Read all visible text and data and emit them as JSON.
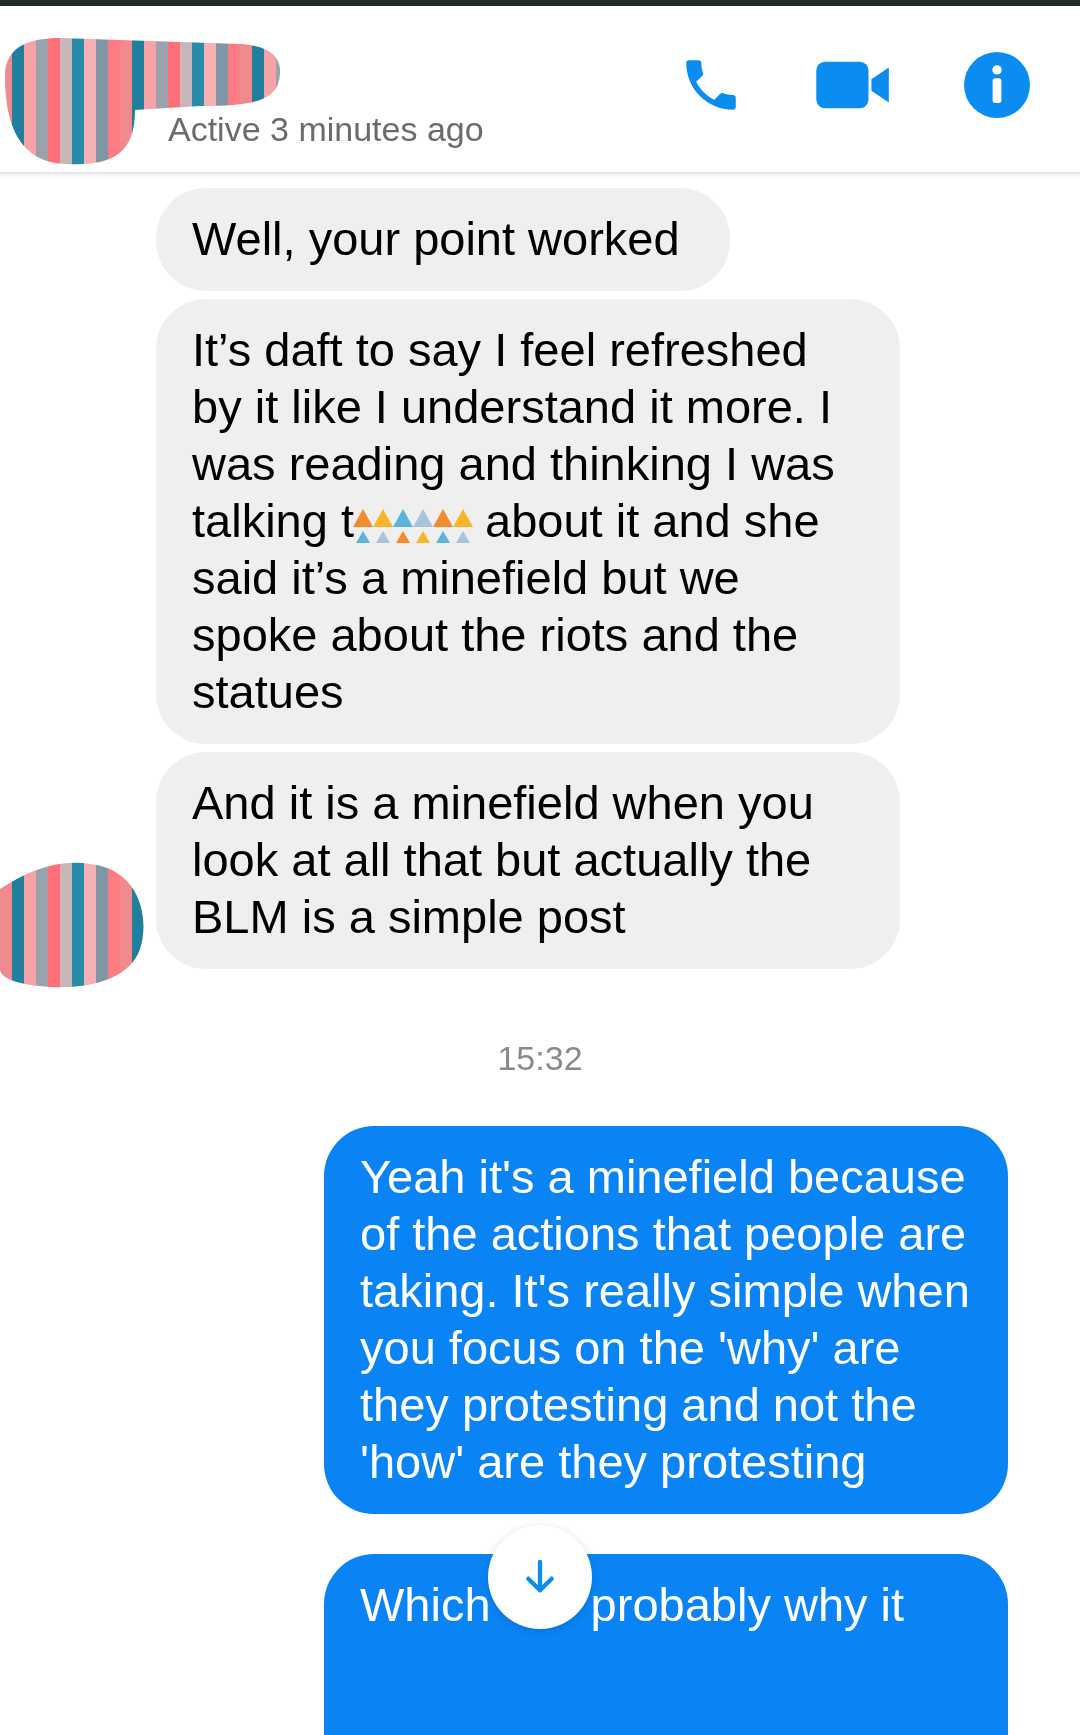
{
  "header": {
    "status": "Active 3 minutes ago",
    "actions": [
      {
        "kind": "call"
      },
      {
        "kind": "video"
      },
      {
        "kind": "info"
      }
    ]
  },
  "messages": [
    {
      "kind": "incoming",
      "parts": [
        {
          "kind": "text",
          "text": "Well, your point worked"
        }
      ]
    },
    {
      "kind": "incoming",
      "parts": [
        {
          "kind": "text",
          "text": "It’s daft to say I feel refreshed by it like I understand it more. I was reading and thinking I was"
        },
        {
          "kind": "text",
          "newline": true,
          "text": "talking t"
        },
        {
          "kind": "redaction"
        },
        {
          "kind": "text",
          "text": " about it and she"
        },
        {
          "kind": "text",
          "newline": true,
          "text": "said it’s a minefield but we spoke about the riots and the statues"
        }
      ]
    },
    {
      "kind": "incoming",
      "avatar": true,
      "parts": [
        {
          "kind": "text",
          "text": "And it is a minefield when you look at all that but actually the BLM is a simple post"
        }
      ]
    },
    {
      "kind": "timestamp",
      "text": "15:32"
    },
    {
      "kind": "outgoing",
      "parts": [
        {
          "kind": "text",
          "text": "Yeah it's a minefield because of the actions that people are taking. It's really simple when you focus on the 'why' are they protesting and not the 'how' are they protesting"
        }
      ]
    },
    {
      "kind": "outgoing",
      "cut": true,
      "parts": [
        {
          "kind": "text",
          "text": "Which"
        },
        {
          "kind": "gap"
        },
        {
          "kind": "text",
          "text": "probably why it"
        }
      ]
    }
  ]
}
